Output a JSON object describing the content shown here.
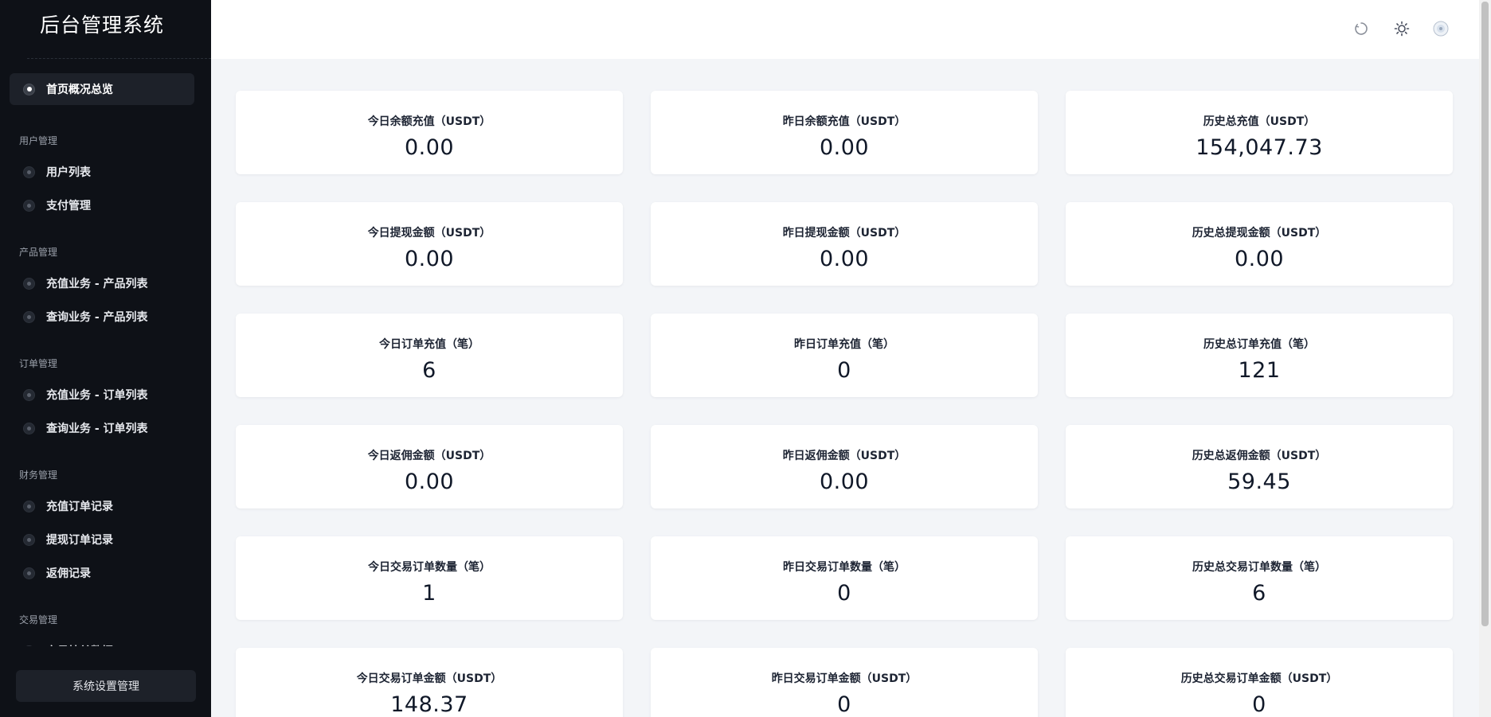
{
  "app": {
    "title": "后台管理系统"
  },
  "sidebar": {
    "items": [
      {
        "type": "item",
        "label": "首页概况总览",
        "active": true
      },
      {
        "type": "group",
        "label": "用户管理"
      },
      {
        "type": "item",
        "label": "用户列表"
      },
      {
        "type": "item",
        "label": "支付管理"
      },
      {
        "type": "group",
        "label": "产品管理"
      },
      {
        "type": "item",
        "label": "充值业务 - 产品列表"
      },
      {
        "type": "item",
        "label": "查询业务 - 产品列表"
      },
      {
        "type": "group",
        "label": "订单管理"
      },
      {
        "type": "item",
        "label": "充值业务 - 订单列表"
      },
      {
        "type": "item",
        "label": "查询业务 - 订单列表"
      },
      {
        "type": "group",
        "label": "财务管理"
      },
      {
        "type": "item",
        "label": "充值订单记录"
      },
      {
        "type": "item",
        "label": "提现订单记录"
      },
      {
        "type": "item",
        "label": "返佣记录"
      },
      {
        "type": "group",
        "label": "交易管理"
      },
      {
        "type": "item",
        "label": "交易挂单数据"
      }
    ],
    "settings_label": "系统设置管理"
  },
  "header": {
    "icons": [
      "refresh-icon",
      "sun-icon",
      "avatar-icon"
    ]
  },
  "stats": [
    {
      "label": "今日余额充值（USDT）",
      "value": "0.00"
    },
    {
      "label": "昨日余额充值（USDT）",
      "value": "0.00"
    },
    {
      "label": "历史总充值（USDT）",
      "value": "154,047.73"
    },
    {
      "label": "今日提现金额（USDT）",
      "value": "0.00"
    },
    {
      "label": "昨日提现金额（USDT）",
      "value": "0.00"
    },
    {
      "label": "历史总提现金额（USDT）",
      "value": "0.00"
    },
    {
      "label": "今日订单充值（笔）",
      "value": "6"
    },
    {
      "label": "昨日订单充值（笔）",
      "value": "0"
    },
    {
      "label": "历史总订单充值（笔）",
      "value": "121"
    },
    {
      "label": "今日返佣金额（USDT）",
      "value": "0.00"
    },
    {
      "label": "昨日返佣金额（USDT）",
      "value": "0.00"
    },
    {
      "label": "历史总返佣金额（USDT）",
      "value": "59.45"
    },
    {
      "label": "今日交易订单数量（笔）",
      "value": "1"
    },
    {
      "label": "昨日交易订单数量（笔）",
      "value": "0"
    },
    {
      "label": "历史总交易订单数量（笔）",
      "value": "6"
    },
    {
      "label": "今日交易订单金额（USDT）",
      "value": "148.37"
    },
    {
      "label": "昨日交易订单金额（USDT）",
      "value": "0"
    },
    {
      "label": "历史总交易订单金额（USDT）",
      "value": "0"
    }
  ]
}
